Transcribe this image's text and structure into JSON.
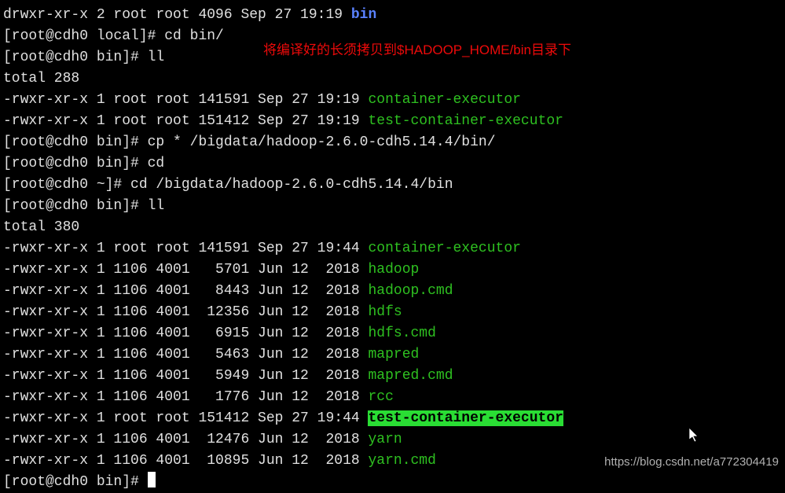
{
  "lines": [
    {
      "segments": [
        {
          "t": "drwxr-xr-x 2 root root 4096 Sep 27 19:19 "
        },
        {
          "t": "bin",
          "cls": "blue"
        }
      ]
    },
    {
      "segments": [
        {
          "t": "[root@cdh0 local]# cd bin/"
        }
      ]
    },
    {
      "segments": [
        {
          "t": "[root@cdh0 bin]# ll"
        }
      ]
    },
    {
      "segments": [
        {
          "t": "total 288"
        }
      ]
    },
    {
      "segments": [
        {
          "t": "-rwxr-xr-x 1 root root 141591 Sep 27 19:19 "
        },
        {
          "t": "container-executor",
          "cls": "green"
        }
      ]
    },
    {
      "segments": [
        {
          "t": "-rwxr-xr-x 1 root root 151412 Sep 27 19:19 "
        },
        {
          "t": "test-container-executor",
          "cls": "green"
        }
      ]
    },
    {
      "segments": [
        {
          "t": "[root@cdh0 bin]# cp * /bigdata/hadoop-2.6.0-cdh5.14.4/bin/"
        }
      ]
    },
    {
      "segments": [
        {
          "t": "[root@cdh0 bin]# cd"
        }
      ]
    },
    {
      "segments": [
        {
          "t": "[root@cdh0 ~]# cd /bigdata/hadoop-2.6.0-cdh5.14.4/bin"
        }
      ]
    },
    {
      "segments": [
        {
          "t": "[root@cdh0 bin]# ll"
        }
      ]
    },
    {
      "segments": [
        {
          "t": "total 380"
        }
      ]
    },
    {
      "segments": [
        {
          "t": "-rwxr-xr-x 1 root root 141591 Sep 27 19:44 "
        },
        {
          "t": "container-executor",
          "cls": "green"
        }
      ]
    },
    {
      "segments": [
        {
          "t": "-rwxr-xr-x 1 1106 4001   5701 Jun 12  2018 "
        },
        {
          "t": "hadoop",
          "cls": "green"
        }
      ]
    },
    {
      "segments": [
        {
          "t": "-rwxr-xr-x 1 1106 4001   8443 Jun 12  2018 "
        },
        {
          "t": "hadoop.cmd",
          "cls": "green"
        }
      ]
    },
    {
      "segments": [
        {
          "t": "-rwxr-xr-x 1 1106 4001  12356 Jun 12  2018 "
        },
        {
          "t": "hdfs",
          "cls": "green"
        }
      ]
    },
    {
      "segments": [
        {
          "t": "-rwxr-xr-x 1 1106 4001   6915 Jun 12  2018 "
        },
        {
          "t": "hdfs.cmd",
          "cls": "green"
        }
      ]
    },
    {
      "segments": [
        {
          "t": "-rwxr-xr-x 1 1106 4001   5463 Jun 12  2018 "
        },
        {
          "t": "mapred",
          "cls": "green"
        }
      ]
    },
    {
      "segments": [
        {
          "t": "-rwxr-xr-x 1 1106 4001   5949 Jun 12  2018 "
        },
        {
          "t": "mapred.cmd",
          "cls": "green"
        }
      ]
    },
    {
      "segments": [
        {
          "t": "-rwxr-xr-x 1 1106 4001   1776 Jun 12  2018 "
        },
        {
          "t": "rcc",
          "cls": "green"
        }
      ]
    },
    {
      "segments": [
        {
          "t": "-rwxr-xr-x 1 root root 151412 Sep 27 19:44 "
        },
        {
          "t": "test-container-executor",
          "cls": "highlight-green"
        }
      ]
    },
    {
      "segments": [
        {
          "t": "-rwxr-xr-x 1 1106 4001  12476 Jun 12  2018 "
        },
        {
          "t": "yarn",
          "cls": "green"
        }
      ]
    },
    {
      "segments": [
        {
          "t": "-rwxr-xr-x 1 1106 4001  10895 Jun 12  2018 "
        },
        {
          "t": "yarn.cmd",
          "cls": "green"
        }
      ]
    },
    {
      "segments": [
        {
          "t": "[root@cdh0 bin]# "
        }
      ],
      "cursor": true
    }
  ],
  "annotation": "将编译好的长须拷贝到$HADOOP_HOME/bin目录下",
  "watermark": "https://blog.csdn.net/a772304419"
}
